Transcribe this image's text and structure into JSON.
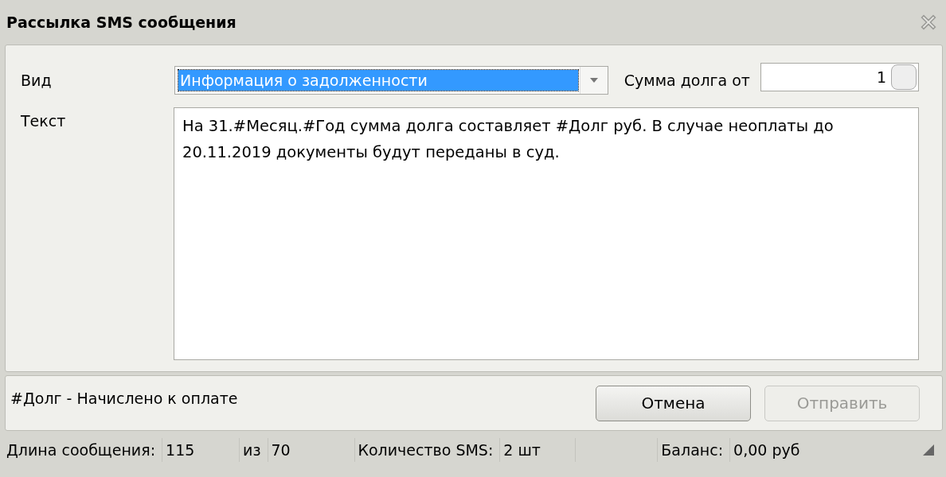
{
  "window": {
    "title": "Рассылка SMS сообщения"
  },
  "form": {
    "type_label": "Вид",
    "type_value": "Информация о задолженности",
    "debt_label": "Сумма долга от",
    "debt_value": "1",
    "text_label": "Текст",
    "text_value": "На 31.#Месяц.#Год сумма долга составляет #Долг руб. В случае неоплаты до 20.11.2019 документы будут переданы в суд."
  },
  "hint": "#Долг - Начислено к оплате",
  "buttons": [
    {
      "label": "Отмена",
      "disabled": false
    },
    {
      "label": "Отправить",
      "disabled": true
    }
  ],
  "status_bar": [
    {
      "kind": "label",
      "text": "Длина сообщения:"
    },
    {
      "kind": "value",
      "text": "115"
    },
    {
      "kind": "label",
      "text": "из"
    },
    {
      "kind": "value",
      "text": "70"
    },
    {
      "kind": "label",
      "text": "Количество SMS:"
    },
    {
      "kind": "value",
      "text": "2 шт"
    },
    {
      "kind": "spacer"
    },
    {
      "kind": "label",
      "text": "Баланс:"
    },
    {
      "kind": "value",
      "text": "0,00 руб"
    }
  ]
}
